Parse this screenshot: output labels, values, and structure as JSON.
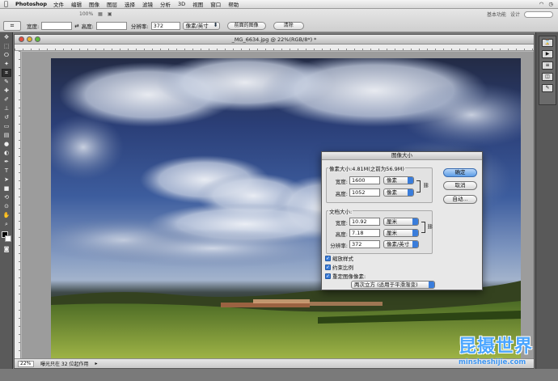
{
  "menubar": {
    "app_name": "Photoshop",
    "items": [
      "文件",
      "编辑",
      "图像",
      "图层",
      "选择",
      "滤镜",
      "分析",
      "3D",
      "视图",
      "窗口",
      "帮助"
    ]
  },
  "optionsbar": {
    "workspace_items": [
      "基本功能",
      "设计"
    ],
    "width_label": "宽度:",
    "width_value": "",
    "height_label": "高度:",
    "height_value": "",
    "resolution_label": "分辨率:",
    "resolution_value": "372",
    "resolution_unit": "像素/英寸",
    "front_image_button": "前面的图像",
    "clear_button": "清除",
    "zoom_display": "100%"
  },
  "document": {
    "title": "_MG_6634.jpg @ 22%(RGB/8*) *",
    "zoom": "22%",
    "status": "曝光只在 32 位起作用"
  },
  "dialog": {
    "title": "图像大小",
    "pixel_dims_label": "像素大小:4.81M(之前为56.9M)",
    "width_label": "宽度:",
    "width_value": "1600",
    "width_unit": "像素",
    "height_label": "高度:",
    "height_value": "1052",
    "height_unit": "像素",
    "doc_size_label": "文档大小:",
    "doc_width_label": "宽度:",
    "doc_width_value": "10.92",
    "doc_width_unit": "厘米",
    "doc_height_label": "高度:",
    "doc_height_value": "7.18",
    "doc_height_unit": "厘米",
    "resolution_label": "分辨率:",
    "resolution_value": "372",
    "resolution_unit": "像素/英寸",
    "scale_styles": "缩放样式",
    "constrain": "约束比例",
    "resample": "重定图像像素:",
    "resample_method": "两次立方 (适用于平滑渐变)",
    "ok": "确定",
    "cancel": "取消",
    "auto": "自动..."
  },
  "watermark": {
    "title": "昆摄世界",
    "url": "minsheshijie.com"
  },
  "colors": {
    "accent": "#3a7ddb",
    "watermark": "#4aa5ff"
  }
}
